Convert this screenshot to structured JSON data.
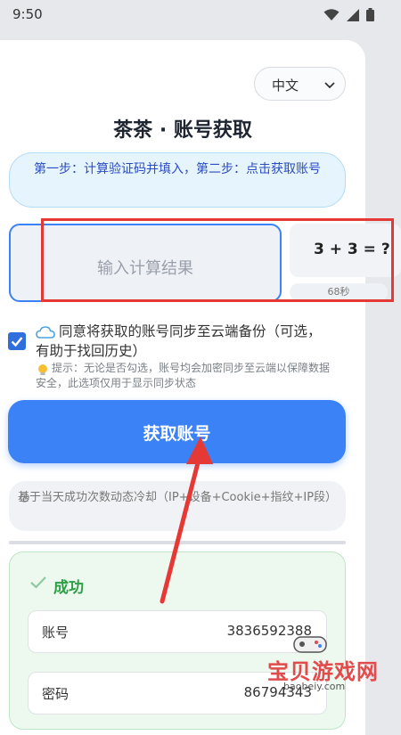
{
  "status": {
    "time": "9:50"
  },
  "lang": {
    "selected": "中文"
  },
  "title": "茶茶 · 账号获取",
  "steps_text": "第一步：计算验证码并填入，第二步：点击获取账号",
  "answer": {
    "placeholder": "输入计算结果"
  },
  "captcha": {
    "question": "3 + 3 = ?",
    "countdown": "68秒"
  },
  "agree": {
    "checked": true,
    "text": "同意将获取的账号同步至云端备份（可选，有助于找回历史）",
    "tip": "提示：无论是否勾选，账号均会加密同步至云端以保障数据安全，此选项仅用于显示同步状态"
  },
  "get_button": "获取账号",
  "cooldown_text": "基于当天成功次数动态冷却（IP+设备+Cookie+指纹+IP段）",
  "result": {
    "title": "成功",
    "account_label": "账号",
    "account_value": "3836592388",
    "password_label": "密码",
    "password_value": "86794343"
  },
  "watermark": {
    "brand": "宝贝游戏网",
    "url": "baobeiy.com"
  },
  "colors": {
    "accent": "#3b82f6",
    "success": "#2e9e47",
    "highlight_box": "#e53935"
  }
}
